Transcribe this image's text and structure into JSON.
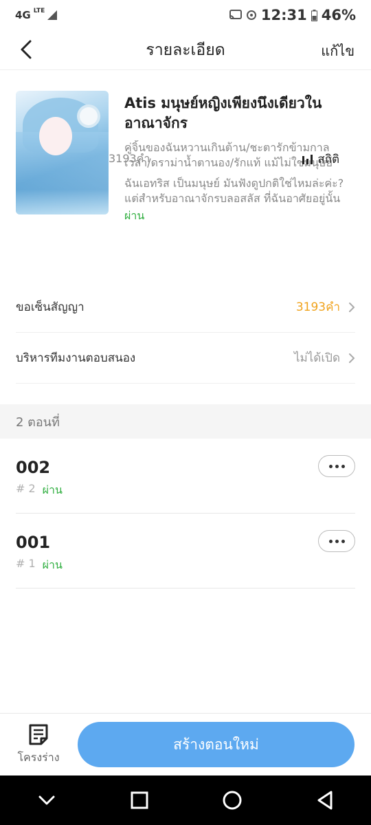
{
  "status_bar": {
    "network": "4G",
    "network_badge": "LTE",
    "time": "12:31",
    "battery": "46%"
  },
  "header": {
    "title": "รายละเอียด",
    "edit_label": "แก้ไข"
  },
  "book": {
    "title": "Atis มนุษย์หญิงเพียงนึงเดียวในอาณาจักร",
    "tags": "คู่จิ้นของฉันหวานเกินต้าน/ชะตารักข้ามกาลเวลา/ดราม่าน้ำตานอง/รักแท้ แม้ไม่ใช่มนุษย์",
    "synopsis": "ฉันเอทริส เป็นมนุษย์ มันฟังดูปกติใช่ไหมล่ะค่ะ? แต่สำหรับอาณาจักรบลอสลัส ที่ฉันอาศัยอยู่นั้น",
    "status": "ผ่าน",
    "word_count": "3193คำ",
    "stats_label": "สถิติ"
  },
  "rows": [
    {
      "label": "ขอเซ็นสัญญา",
      "value": "3193คำ",
      "value_color": "#f0a21b"
    },
    {
      "label": "บริหารทีมงานตอบสนอง",
      "value": "ไม่ได้เปิด",
      "value_color": "#999999"
    }
  ],
  "chapters_header": "2 ตอนที่",
  "chapters": [
    {
      "title": "002",
      "number": "# 2",
      "status": "ผ่าน"
    },
    {
      "title": "001",
      "number": "# 1",
      "status": "ผ่าน"
    }
  ],
  "bottom": {
    "outline_label": "โครงร่าง",
    "create_label": "สร้างตอนใหม่"
  },
  "colors": {
    "accent": "#5da9f0",
    "pass_green": "#2fae3f",
    "contract_orange": "#f0a21b"
  }
}
